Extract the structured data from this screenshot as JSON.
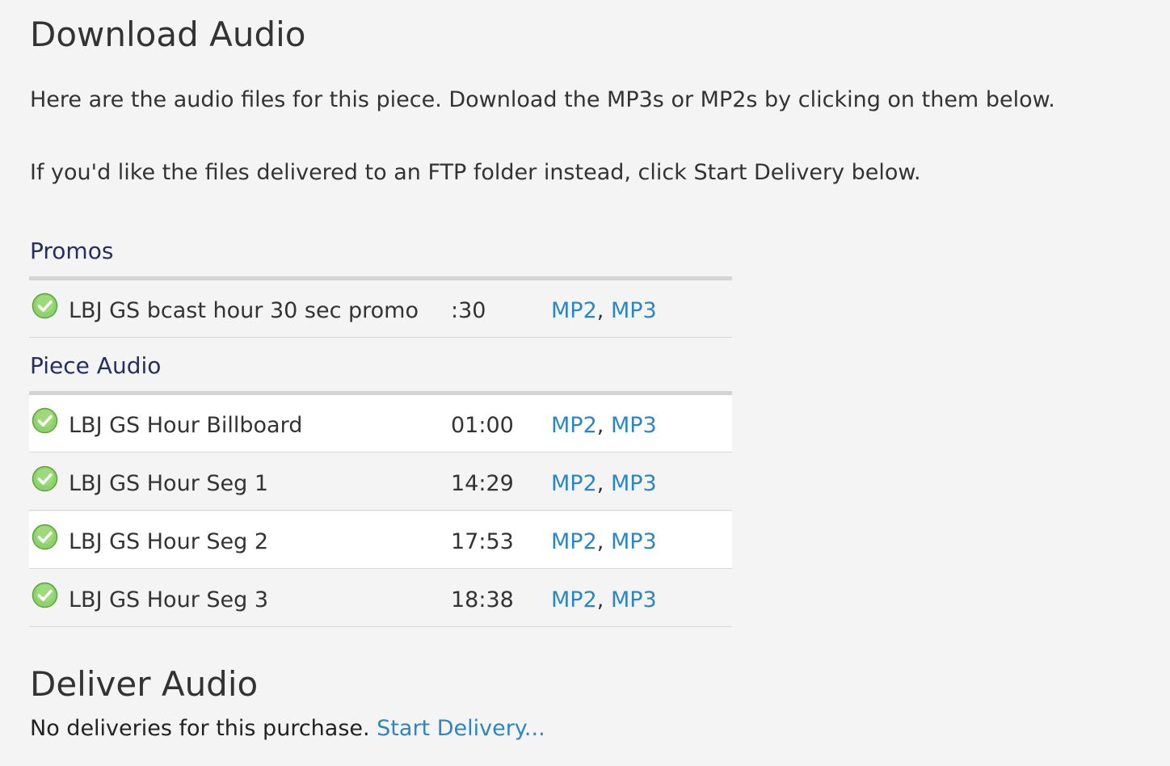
{
  "download": {
    "title": "Download Audio",
    "intro_line1": "Here are the audio files for this piece. Download the MP3s or MP2s by clicking on them below.",
    "intro_line2": "If you'd like the files delivered to an FTP folder instead, click Start Delivery below."
  },
  "promos": {
    "label": "Promos",
    "rows": [
      {
        "name": "LBJ GS bcast hour 30 sec promo",
        "duration": ":30",
        "mp2": "MP2",
        "sep": ", ",
        "mp3": "MP3",
        "status_icon": "check-circle-icon"
      }
    ]
  },
  "piece": {
    "label": "Piece Audio",
    "rows": [
      {
        "name": "LBJ GS Hour Billboard",
        "duration": "01:00",
        "mp2": "MP2",
        "sep": ", ",
        "mp3": "MP3",
        "status_icon": "check-circle-icon"
      },
      {
        "name": "LBJ GS Hour Seg 1",
        "duration": "14:29",
        "mp2": "MP2",
        "sep": ", ",
        "mp3": "MP3",
        "status_icon": "check-circle-icon"
      },
      {
        "name": "LBJ GS Hour Seg 2",
        "duration": "17:53",
        "mp2": "MP2",
        "sep": ", ",
        "mp3": "MP3",
        "status_icon": "check-circle-icon"
      },
      {
        "name": "LBJ GS Hour Seg 3",
        "duration": "18:38",
        "mp2": "MP2",
        "sep": ", ",
        "mp3": "MP3",
        "status_icon": "check-circle-icon"
      }
    ]
  },
  "deliver": {
    "title": "Deliver Audio",
    "status_text": "No deliveries for this purchase. ",
    "start_link": "Start Delivery..."
  },
  "colors": {
    "background": "#f4f4f4",
    "heading_text": "#333333",
    "section_label": "#253061",
    "link": "#2e86c1",
    "check_green": "#6cbf4a",
    "rule": "#d4d4d4"
  }
}
